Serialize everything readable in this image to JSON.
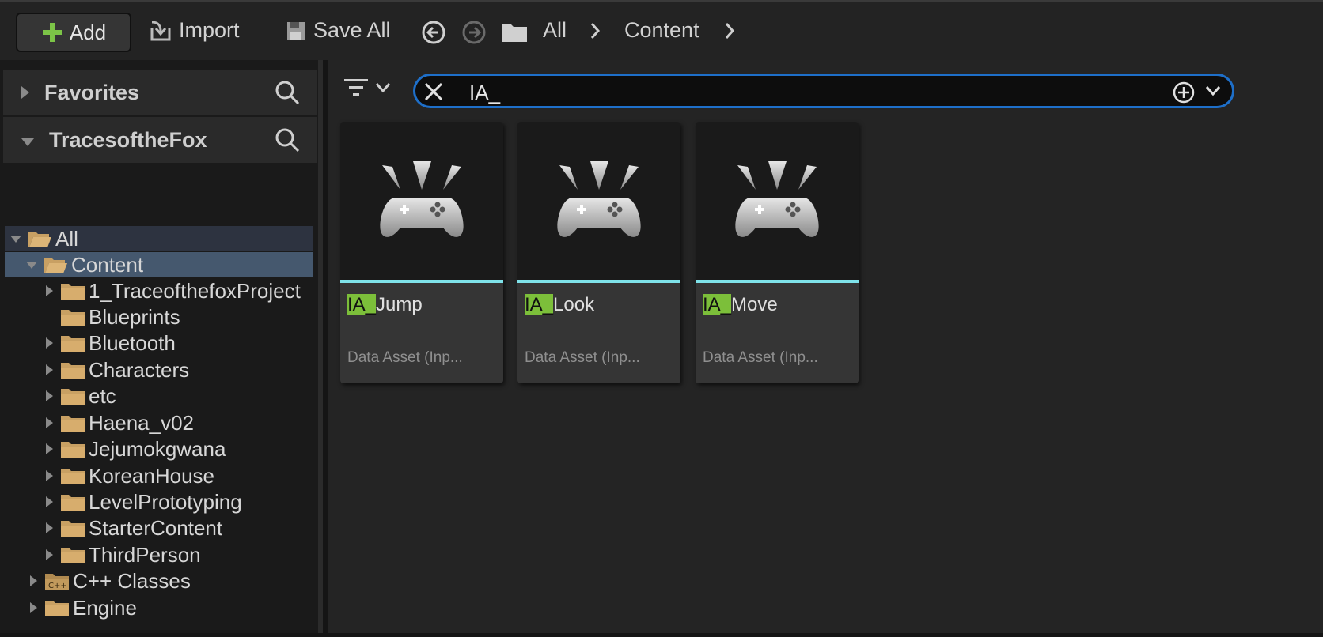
{
  "toolbar": {
    "add_label": "Add",
    "import_label": "Import",
    "save_all_label": "Save All",
    "breadcrumbs": [
      "All",
      "Content"
    ]
  },
  "sidebar": {
    "favorites_label": "Favorites",
    "project_label": "TracesoftheFox",
    "tree": [
      {
        "label": "All",
        "expanded": true,
        "selected": false
      },
      {
        "label": "Content",
        "expanded": true,
        "selected": true
      },
      {
        "label": "1_TraceofthefoxProject",
        "expanded": false
      },
      {
        "label": "Blueprints",
        "expanded": false
      },
      {
        "label": "Bluetooth",
        "expanded": false
      },
      {
        "label": "Characters",
        "expanded": false
      },
      {
        "label": "etc",
        "expanded": false
      },
      {
        "label": "Haena_v02",
        "expanded": false
      },
      {
        "label": "Jejumokgwana",
        "expanded": false
      },
      {
        "label": "KoreanHouse",
        "expanded": false
      },
      {
        "label": "LevelPrototyping",
        "expanded": false
      },
      {
        "label": "StarterContent",
        "expanded": false
      },
      {
        "label": "ThirdPerson",
        "expanded": false
      },
      {
        "label": "C++ Classes",
        "expanded": false
      },
      {
        "label": "Engine",
        "expanded": false
      }
    ]
  },
  "search": {
    "value": "IA_"
  },
  "assets": [
    {
      "prefix": "IA_",
      "rest": "Jump",
      "type": "Data Asset (Inp..."
    },
    {
      "prefix": "IA_",
      "rest": "Look",
      "type": "Data Asset (Inp..."
    },
    {
      "prefix": "IA_",
      "rest": "Move",
      "type": "Data Asset (Inp..."
    }
  ],
  "colors": {
    "accent_search_border": "#1e6fc9",
    "asset_bar": "#7fe3ea",
    "highlight": "#7cbf3a",
    "folder": "#c8a063"
  }
}
